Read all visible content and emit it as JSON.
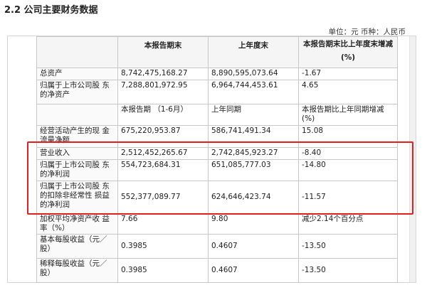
{
  "page": {
    "title": "2.2 公司主要财务数据",
    "unit_text": "单位：元 币种：人民币"
  },
  "table": {
    "header": {
      "col1": "",
      "col2": "本报告期末",
      "col3": "上年度末",
      "col4_line1": "本报告期末比上年度末增减",
      "col4_line2": "(%)"
    },
    "rows": [
      {
        "label": "总资产",
        "v1": "8,742,475,168.27",
        "v2": "8,890,595,073.64",
        "v3": "-1.67"
      },
      {
        "label": "归属于上市公司股 东的净资产",
        "v1": "7,288,801,972.95",
        "v2": "6,964,744,453.61",
        "v3": "4.65"
      }
    ],
    "subheader": {
      "col1": "",
      "col2": "本报告期 （1-6月）",
      "col3": "上年同期",
      "col4": "本报告期比上年同期增减(%)"
    },
    "rows2": [
      {
        "label": "经营活动产生的现 金流量净额",
        "v1": "675,220,953.87",
        "v2": "586,741,491.34",
        "v3": "15.08"
      },
      {
        "label": "营业收入",
        "v1": "2,512,452,265.67",
        "v2": "2,742,845,923.27",
        "v3": "-8.40"
      },
      {
        "label": "归属于上市公司股 东的净利润",
        "v1": "554,723,684.31",
        "v2": "651,085,777.03",
        "v3": "-14.80"
      },
      {
        "label": "归属于上市公司股 东的扣除非经常性 损益的净利润",
        "v1": "552,377,089.77",
        "v2": "624,646,423.74",
        "v3": "-11.57"
      },
      {
        "label": "加权平均净资产收 益率（%）",
        "v1": "7.66",
        "v2": "9.80",
        "v3": "减少2.14个百分点"
      },
      {
        "label": "基本每股收益（元／股）",
        "v1": "0.3985",
        "v2": "0.4607",
        "v3": "-13.50"
      },
      {
        "label": "稀释每股收益（元／股）",
        "v1": "0.3985",
        "v2": "0.4607",
        "v3": "-13.50"
      }
    ]
  },
  "colors": {
    "highlight_border": "#e02020"
  }
}
